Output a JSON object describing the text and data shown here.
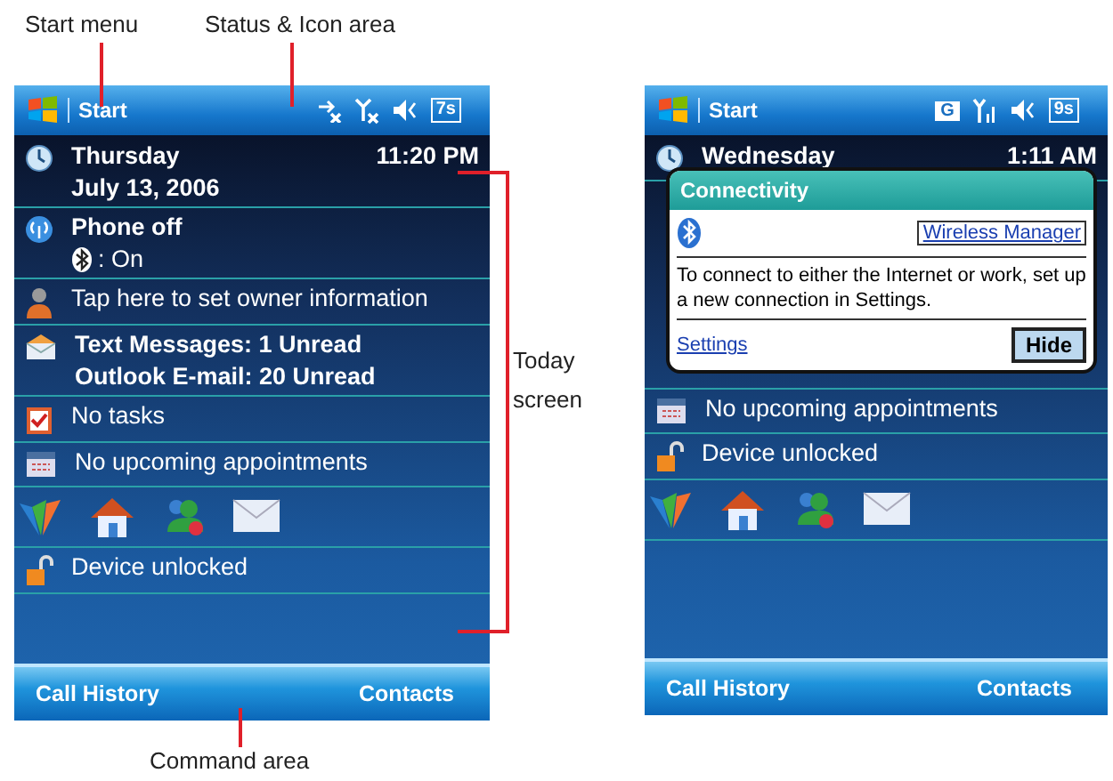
{
  "callouts": {
    "start_menu": "Start menu",
    "status_area": "Status & Icon area",
    "today_screen": "Today screen",
    "command_area": "Command area"
  },
  "screens": [
    {
      "title_bar": {
        "start": "Start",
        "status_icons": [
          {
            "kind": "data_off"
          },
          {
            "kind": "signal_off"
          },
          {
            "kind": "speaker"
          },
          {
            "kind": "indicator",
            "text": "7s"
          }
        ]
      },
      "items": [
        {
          "kind": "date",
          "lines": [
            "Thursday",
            "July 13, 2006"
          ],
          "time": "11:20 PM"
        },
        {
          "kind": "phone",
          "title": "Phone off",
          "bluetooth": ": On"
        },
        {
          "kind": "owner",
          "text": "Tap here to set owner information"
        },
        {
          "kind": "messages",
          "lines": [
            "Text Messages: 1 Unread",
            "Outlook E-mail: 20 Unread"
          ]
        },
        {
          "kind": "tasks",
          "text": "No tasks"
        },
        {
          "kind": "appointments",
          "text": "No upcoming appointments"
        },
        {
          "kind": "shortcuts"
        },
        {
          "kind": "lock",
          "text": "Device unlocked"
        }
      ],
      "command_bar": {
        "left": "Call History",
        "right": "Contacts"
      }
    },
    {
      "title_bar": {
        "start": "Start",
        "status_icons": [
          {
            "kind": "gprs",
            "text": "G"
          },
          {
            "kind": "signal"
          },
          {
            "kind": "speaker"
          },
          {
            "kind": "indicator",
            "text": "9s"
          }
        ]
      },
      "items": [
        {
          "kind": "date",
          "lines": [
            "Wednesday"
          ],
          "time": "1:11 AM"
        },
        {
          "kind": "hidden"
        },
        {
          "kind": "appointments",
          "text": "No upcoming appointments"
        },
        {
          "kind": "lock",
          "text": "Device unlocked"
        },
        {
          "kind": "shortcuts"
        }
      ],
      "notification": {
        "title": "Connectivity",
        "link": "Wireless Manager",
        "message": "To connect to either the Internet or work, set up a new connection in Settings.",
        "settings_link": "Settings",
        "button": "Hide"
      },
      "command_bar": {
        "left": "Call History",
        "right": "Contacts"
      }
    }
  ]
}
